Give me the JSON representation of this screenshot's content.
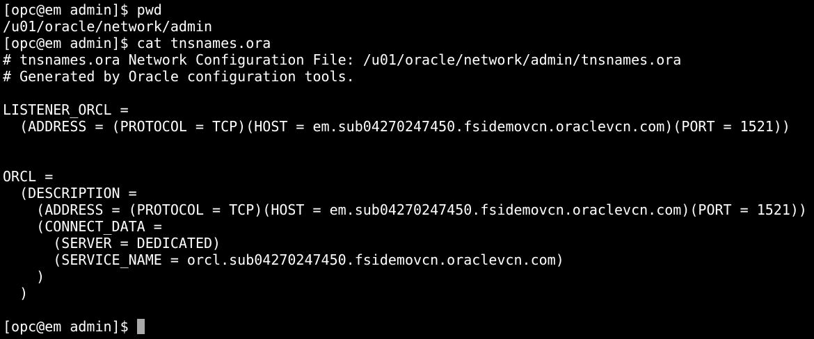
{
  "terminal": {
    "lines": [
      "[opc@em admin]$ pwd",
      "/u01/oracle/network/admin",
      "[opc@em admin]$ cat tnsnames.ora",
      "# tnsnames.ora Network Configuration File: /u01/oracle/network/admin/tnsnames.ora",
      "# Generated by Oracle configuration tools.",
      "",
      "LISTENER_ORCL =",
      "  (ADDRESS = (PROTOCOL = TCP)(HOST = em.sub04270247450.fsidemovcn.oraclevcn.com)(PORT = 1521))",
      "",
      "",
      "ORCL =",
      "  (DESCRIPTION =",
      "    (ADDRESS = (PROTOCOL = TCP)(HOST = em.sub04270247450.fsidemovcn.oraclevcn.com)(PORT = 1521))",
      "    (CONNECT_DATA =",
      "      (SERVER = DEDICATED)",
      "      (SERVICE_NAME = orcl.sub04270247450.fsidemovcn.oraclevcn.com)",
      "    )",
      "  )",
      "",
      "[opc@em admin]$ "
    ],
    "colors": {
      "background": "#000000",
      "foreground": "#ffffff",
      "cursor": "#aaaaaa"
    }
  }
}
